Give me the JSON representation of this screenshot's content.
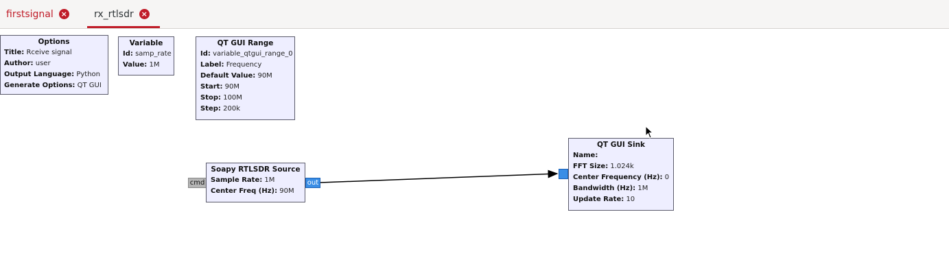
{
  "tabs": [
    {
      "label": "firstsignal",
      "active": false
    },
    {
      "label": "rx_rtlsdr",
      "active": true
    }
  ],
  "blocks": {
    "options": {
      "title": "Options",
      "rows": [
        {
          "k": "Title:",
          "v": "Rceive signal"
        },
        {
          "k": "Author:",
          "v": "user"
        },
        {
          "k": "Output Language:",
          "v": "Python"
        },
        {
          "k": "Generate Options:",
          "v": "QT GUI"
        }
      ]
    },
    "variable": {
      "title": "Variable",
      "rows": [
        {
          "k": "Id:",
          "v": "samp_rate"
        },
        {
          "k": "Value:",
          "v": "1M"
        }
      ]
    },
    "range": {
      "title": "QT GUI Range",
      "rows": [
        {
          "k": "Id:",
          "v": "variable_qtgui_range_0"
        },
        {
          "k": "Label:",
          "v": "Frequency"
        },
        {
          "k": "Default Value:",
          "v": "90M"
        },
        {
          "k": "Start:",
          "v": "90M"
        },
        {
          "k": "Stop:",
          "v": "100M"
        },
        {
          "k": "Step:",
          "v": "200k"
        }
      ]
    },
    "soapy": {
      "title": "Soapy RTLSDR Source",
      "rows": [
        {
          "k": "Sample Rate:",
          "v": "1M"
        },
        {
          "k": "Center Freq (Hz):",
          "v": "90M"
        }
      ]
    },
    "sink": {
      "title": "QT GUI Sink",
      "rows": [
        {
          "k": "Name:",
          "v": ""
        },
        {
          "k": "FFT Size:",
          "v": "1.024k"
        },
        {
          "k": "Center Frequency (Hz):",
          "v": "0"
        },
        {
          "k": "Bandwidth (Hz):",
          "v": "1M"
        },
        {
          "k": "Update Rate:",
          "v": "10"
        }
      ]
    }
  },
  "ports": {
    "cmd": "cmd",
    "out": "out",
    "in": "in"
  },
  "colors": {
    "accent": "#c01c28",
    "block_fill": "#eeeeff",
    "port_stream": "#3a8ee6",
    "port_msg": "#b5b5b5"
  }
}
